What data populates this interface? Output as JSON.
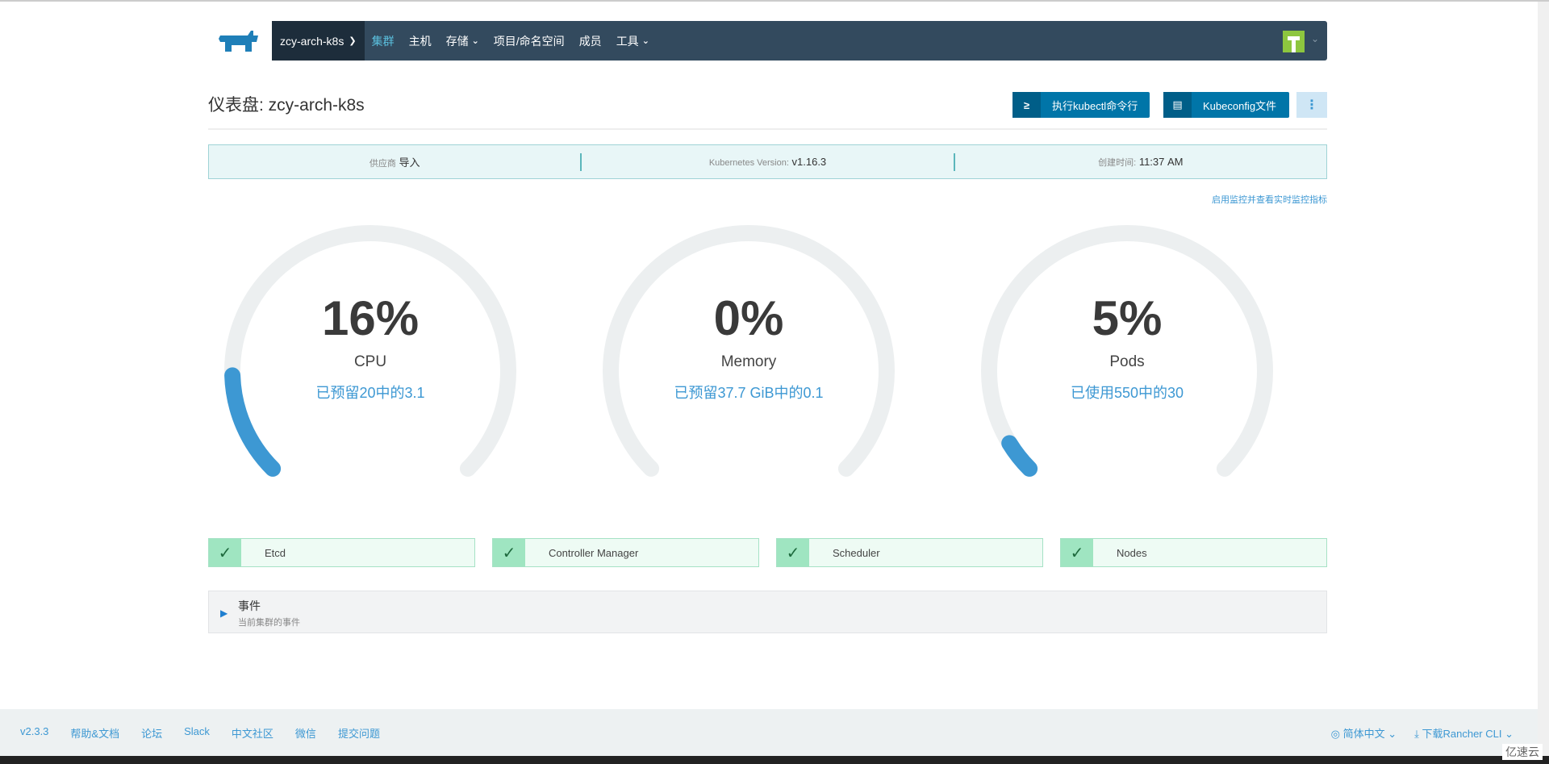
{
  "nav": {
    "cluster": "zcy-arch-k8s",
    "items": [
      {
        "label": "集群",
        "active": true
      },
      {
        "label": "主机"
      },
      {
        "label": "存储",
        "dropdown": true
      },
      {
        "label": "项目/命名空间"
      },
      {
        "label": "成员"
      },
      {
        "label": "工具",
        "dropdown": true
      }
    ]
  },
  "header": {
    "title": "仪表盘: zcy-arch-k8s",
    "kubectl_button": "执行kubectl命令行",
    "kubeconfig_button": "Kubeconfig文件"
  },
  "info": {
    "provider_label": "供应商",
    "provider": "导入",
    "version_label": "Kubernetes Version:",
    "version": "v1.16.3",
    "created_label": "创建时间:",
    "created": "11:37 AM"
  },
  "monitor_link": "启用监控并查看实时监控指标",
  "gauges": [
    {
      "percent_text": "16%",
      "percent": 16,
      "label": "CPU",
      "sub": "已预留20中的3.1"
    },
    {
      "percent_text": "0%",
      "percent": 0,
      "label": "Memory",
      "sub": "已预留37.7 GiB中的0.1"
    },
    {
      "percent_text": "5%",
      "percent": 5,
      "label": "Pods",
      "sub": "已使用550中的30"
    }
  ],
  "components": [
    {
      "label": "Etcd",
      "status": "ok"
    },
    {
      "label": "Controller Manager",
      "status": "ok"
    },
    {
      "label": "Scheduler",
      "status": "ok"
    },
    {
      "label": "Nodes",
      "status": "ok"
    }
  ],
  "events": {
    "title": "事件",
    "subtitle": "当前集群的事件"
  },
  "footer": {
    "links": [
      "v2.3.3",
      "帮助&文档",
      "论坛",
      "Slack",
      "中文社区",
      "微信",
      "提交问题"
    ],
    "language": "简体中文",
    "cli": "下载Rancher CLI"
  },
  "watermark": "亿速云",
  "colors": {
    "nav": "#334a5e",
    "accent": "#3d98d3",
    "gauge_fill": "#3d98d3",
    "gauge_track": "#eceff0",
    "ok": "#9fe5c1"
  }
}
